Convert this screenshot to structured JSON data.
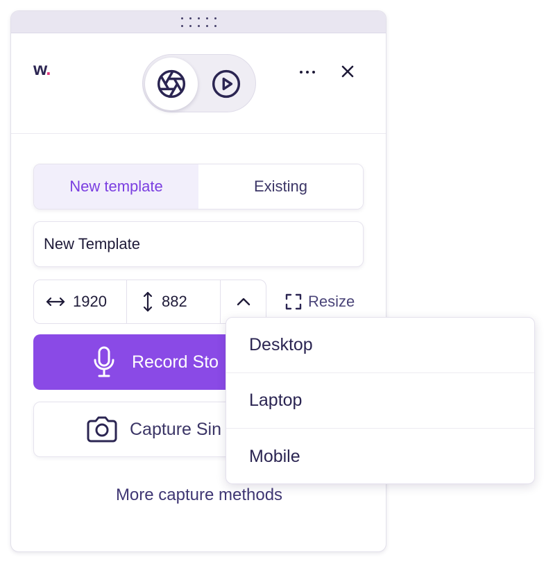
{
  "header": {
    "logo_text": "w",
    "logo_dot": ".",
    "modes": [
      {
        "name": "screenshot",
        "icon": "aperture-icon",
        "active": true
      },
      {
        "name": "video",
        "icon": "play-circle-icon",
        "active": false
      }
    ],
    "menu_icon": "more-horizontal-icon",
    "close_icon": "close-icon"
  },
  "tabs": [
    {
      "label": "New template",
      "active": true
    },
    {
      "label": "Existing",
      "active": false
    }
  ],
  "template_name": {
    "value": "New Template"
  },
  "dimensions": {
    "width": "1920",
    "height": "882",
    "width_icon": "horizontal-arrows-icon",
    "height_icon": "vertical-arrows-icon",
    "toggle_icon": "chevron-up-icon"
  },
  "resize": {
    "label": "Resize",
    "icon": "expand-corners-icon"
  },
  "record_button": {
    "label": "Record Sto",
    "icon": "microphone-icon"
  },
  "capture_button": {
    "label": "Capture Sin",
    "icon": "camera-icon"
  },
  "more_link": "More capture methods",
  "dropdown": {
    "items": [
      "Desktop",
      "Laptop",
      "Mobile"
    ]
  },
  "colors": {
    "accent": "#8a4ae6",
    "accent_text": "#7a3ee0",
    "logo_dot": "#e0357a",
    "text_dark": "#2b2552"
  }
}
